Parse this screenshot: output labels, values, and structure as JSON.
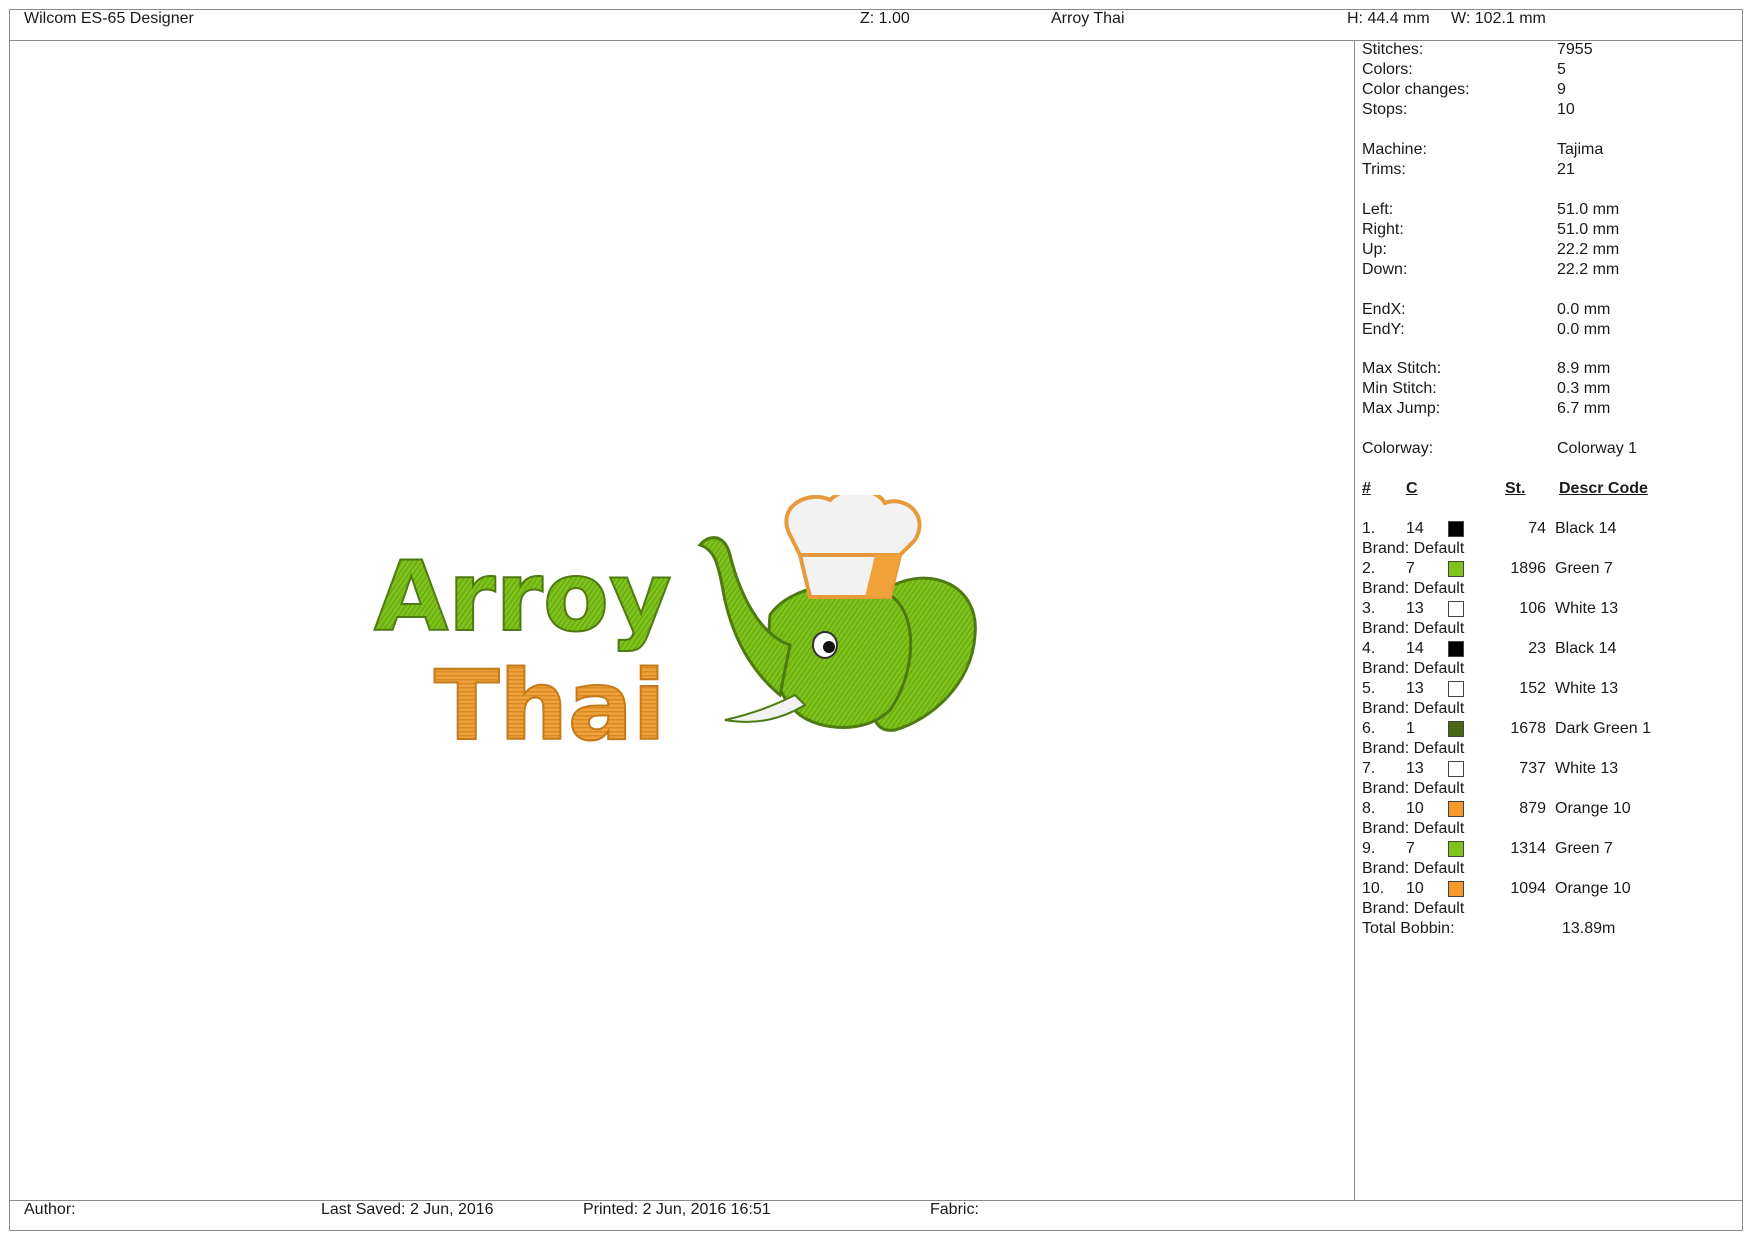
{
  "header": {
    "app_title": "Wilcom ES-65 Designer",
    "zoom": "Z: 1.00",
    "design_name": "Arroy Thai",
    "height": "H: 44.4 mm",
    "width": "W: 102.1 mm"
  },
  "design": {
    "line1": "Arroy",
    "line2": "Thai",
    "colors": {
      "green": "#7fc31c",
      "dark_green": "#4e7a12",
      "orange": "#f0a13a",
      "white": "#f2f2f2",
      "hat_outline": "#e79a3c"
    }
  },
  "stats": [
    {
      "label": "Stitches:",
      "value": "7955"
    },
    {
      "label": "Colors:",
      "value": "5"
    },
    {
      "label": "Color changes:",
      "value": "9"
    },
    {
      "label": "Stops:",
      "value": "10"
    },
    {
      "label": "Machine:",
      "value": "Tajima"
    },
    {
      "label": "Trims:",
      "value": "21"
    },
    {
      "label": "Left:",
      "value": "51.0 mm"
    },
    {
      "label": "Right:",
      "value": "51.0 mm"
    },
    {
      "label": "Up:",
      "value": "22.2 mm"
    },
    {
      "label": "Down:",
      "value": "22.2 mm"
    },
    {
      "label": "EndX:",
      "value": "0.0 mm"
    },
    {
      "label": "EndY:",
      "value": "0.0 mm"
    },
    {
      "label": "Max Stitch:",
      "value": "8.9 mm"
    },
    {
      "label": "Min Stitch:",
      "value": "0.3 mm"
    },
    {
      "label": "Max Jump:",
      "value": "6.7 mm"
    },
    {
      "label": "Colorway:",
      "value": "Colorway 1"
    }
  ],
  "color_table": {
    "headers": {
      "num": "#",
      "c": "C",
      "st": "St.",
      "descr": "Descr Code"
    },
    "rows": [
      {
        "idx": "1.",
        "code": "14",
        "color": "#000000",
        "stitches": "74",
        "descr": "Black 14",
        "brand": "Brand: Default"
      },
      {
        "idx": "2.",
        "code": "7",
        "color": "#7fc31c",
        "stitches": "1896",
        "descr": "Green 7",
        "brand": "Brand: Default"
      },
      {
        "idx": "3.",
        "code": "13",
        "color": "#ffffff",
        "stitches": "106",
        "descr": "White 13",
        "brand": "Brand: Default"
      },
      {
        "idx": "4.",
        "code": "14",
        "color": "#000000",
        "stitches": "23",
        "descr": "Black 14",
        "brand": "Brand: Default"
      },
      {
        "idx": "5.",
        "code": "13",
        "color": "#ffffff",
        "stitches": "152",
        "descr": "White 13",
        "brand": "Brand: Default"
      },
      {
        "idx": "6.",
        "code": "1",
        "color": "#4b6614",
        "stitches": "1678",
        "descr": "Dark Green 1",
        "brand": "Brand: Default"
      },
      {
        "idx": "7.",
        "code": "13",
        "color": "#ffffff",
        "stitches": "737",
        "descr": "White 13",
        "brand": "Brand: Default"
      },
      {
        "idx": "8.",
        "code": "10",
        "color": "#f59a2b",
        "stitches": "879",
        "descr": "Orange 10",
        "brand": "Brand: Default"
      },
      {
        "idx": "9.",
        "code": "7",
        "color": "#7fc31c",
        "stitches": "1314",
        "descr": "Green 7",
        "brand": "Brand: Default"
      },
      {
        "idx": "10.",
        "code": "10",
        "color": "#f59a2b",
        "stitches": "1094",
        "descr": "Orange 10",
        "brand": "Brand: Default"
      }
    ],
    "total_label": "Total Bobbin:",
    "total_value": "13.89m"
  },
  "footer": {
    "author_label": "Author:",
    "last_saved": "Last Saved:  2 Jun, 2016",
    "printed": "Printed:  2 Jun, 2016 16:51",
    "fabric_label": "Fabric:"
  }
}
